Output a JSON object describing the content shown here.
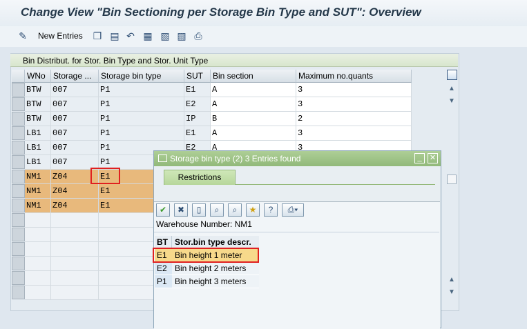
{
  "title": "Change View \"Bin Sectioning per Storage Bin Type and SUT\": Overview",
  "toolbar": {
    "new_entries_label": "New Entries",
    "icons": [
      "display-change-icon",
      "copy-icon",
      "delete-icon",
      "undo-icon",
      "select-all-icon",
      "select-block-icon",
      "deselect-all-icon",
      "print-icon"
    ]
  },
  "table": {
    "caption": "Bin Distribut. for Stor. Bin Type and Stor. Unit Type",
    "columns": [
      "WNo",
      "Storage ...",
      "Storage bin type",
      "SUT",
      "Bin section",
      "Maximum no.quants"
    ],
    "rows": [
      [
        "BTW",
        "007",
        "P1",
        "E1",
        "A",
        "3"
      ],
      [
        "BTW",
        "007",
        "P1",
        "E2",
        "A",
        "3"
      ],
      [
        "BTW",
        "007",
        "P1",
        "IP",
        "B",
        "2"
      ],
      [
        "LB1",
        "007",
        "P1",
        "E1",
        "A",
        "3"
      ],
      [
        "LB1",
        "007",
        "P1",
        "E2",
        "A",
        "3"
      ],
      [
        "LB1",
        "007",
        "P1",
        "",
        "",
        ""
      ],
      [
        "NM1",
        "Z04",
        "E1",
        "",
        "",
        ""
      ],
      [
        "NM1",
        "Z04",
        "E1",
        "",
        "",
        ""
      ],
      [
        "NM1",
        "Z04",
        "E1",
        "",
        "",
        ""
      ]
    ],
    "colors": {
      "highlight_row": "#e8b97c",
      "input_cell": "#ffffff"
    }
  },
  "dialog": {
    "title": "Storage bin type (2)   3 Entries found",
    "tab_label": "Restrictions",
    "warehouse_label": "Warehouse Number: NM1",
    "result_columns": [
      "BT",
      "Stor.bin type descr."
    ],
    "results": [
      {
        "key": "E1",
        "desc": "Bin height 1 meter"
      },
      {
        "key": "E2",
        "desc": "Bin height 2 meters"
      },
      {
        "key": "P1",
        "desc": "Bin height 3 meters"
      }
    ],
    "toolbar_icons": [
      "checkmark-icon",
      "cancel-icon",
      "new-icon",
      "find-icon",
      "find-next-icon",
      "favorites-icon",
      "help-icon",
      "print-icon"
    ]
  }
}
